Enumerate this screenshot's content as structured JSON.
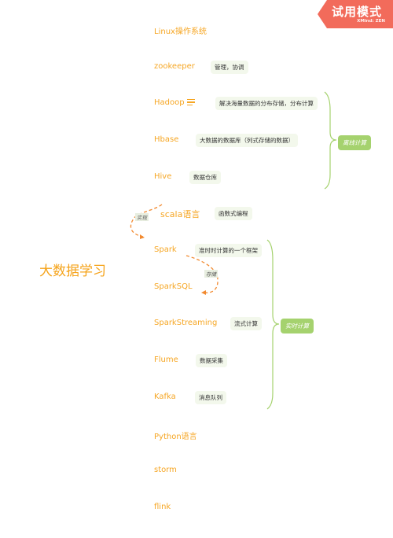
{
  "badge": {
    "title": "试用模式",
    "subtitle": "XMind: ZEN",
    "color": "#f26b5b"
  },
  "central_topic": {
    "label": "大数据学习",
    "color": "#f5a31a"
  },
  "topics": [
    {
      "label": "Linux操作系统"
    },
    {
      "label": "zookeeper",
      "label_note": "管理，协调"
    },
    {
      "label": "Hadoop",
      "label_note": "解决海量数据的分布存储，分布计算",
      "has_notes_icon": true
    },
    {
      "label": "Hbase",
      "label_note": "大数据的数据库（列式存储的数据）"
    },
    {
      "label": "Hive",
      "label_note": "数据仓库"
    },
    {
      "label": "scala语言",
      "label_note": "函数式编程"
    },
    {
      "label": "Spark",
      "label_note": "准时时计算的一个框架"
    },
    {
      "label": "SparkSQL"
    },
    {
      "label": "SparkStreaming",
      "label_note": "流式计算"
    },
    {
      "label": "Flume",
      "label_note": "数据采集"
    },
    {
      "label": "Kafka",
      "label_note": "消息队列"
    },
    {
      "label": "Python语言"
    },
    {
      "label": "storm"
    },
    {
      "label": "flink"
    }
  ],
  "summaries": [
    {
      "label": "离线计算",
      "covers": [
        "Hadoop",
        "Hbase",
        "Hive"
      ],
      "color": "#a5d26e"
    },
    {
      "label": "实时计算",
      "covers": [
        "Spark",
        "SparkSQL",
        "SparkStreaming",
        "Flume",
        "Kafka"
      ],
      "color": "#a5d26e"
    }
  ],
  "relationships": [
    {
      "from": "scala语言",
      "to": "Spark",
      "label": "实现",
      "color": "#f28a30"
    },
    {
      "from": "Spark",
      "to": "SparkSQL",
      "label": "存储",
      "color": "#f28a30"
    }
  ]
}
